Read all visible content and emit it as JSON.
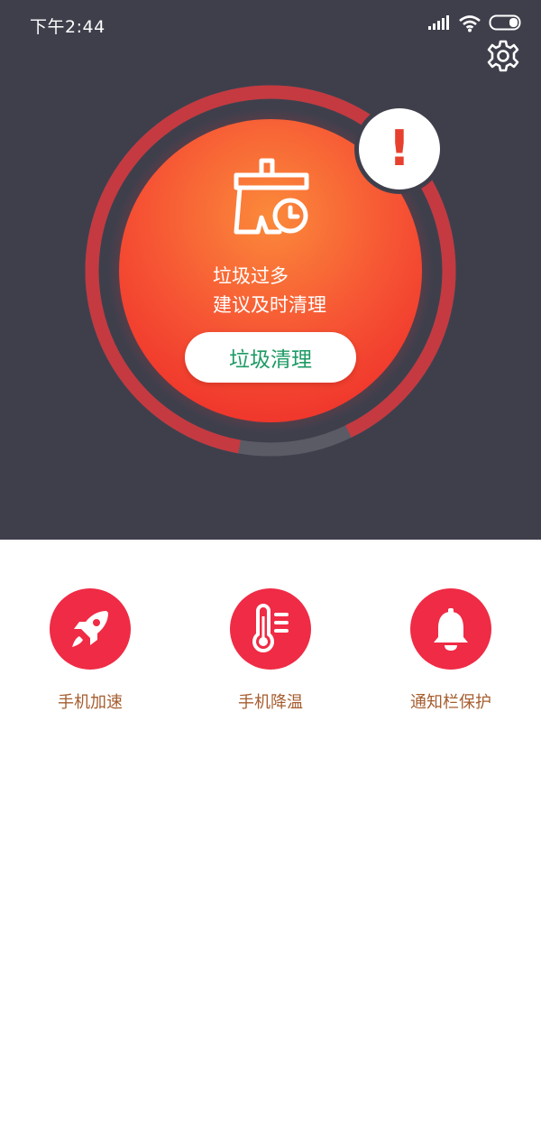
{
  "status_bar": {
    "time": "下午2:44",
    "icons": [
      "signal-icon",
      "wifi-icon",
      "battery-icon"
    ]
  },
  "header": {
    "settings_icon": "gear-icon"
  },
  "cleaner": {
    "status_line1": "垃圾过多",
    "status_line2": "建议及时清理",
    "clean_button_label": "垃圾清理",
    "alert_symbol": "!",
    "icon": "broom-clock-icon",
    "storage_used_fraction": 0.9
  },
  "features": [
    {
      "label": "手机加速",
      "icon": "rocket-icon"
    },
    {
      "label": "手机降温",
      "icon": "thermometer-icon"
    },
    {
      "label": "通知栏保护",
      "icon": "bell-icon"
    }
  ],
  "colors": {
    "top_background": "#3f3f4c",
    "accent_red": "#ef2b45",
    "button_text_green": "#1e9a64",
    "feature_label": "#a65d2f"
  }
}
